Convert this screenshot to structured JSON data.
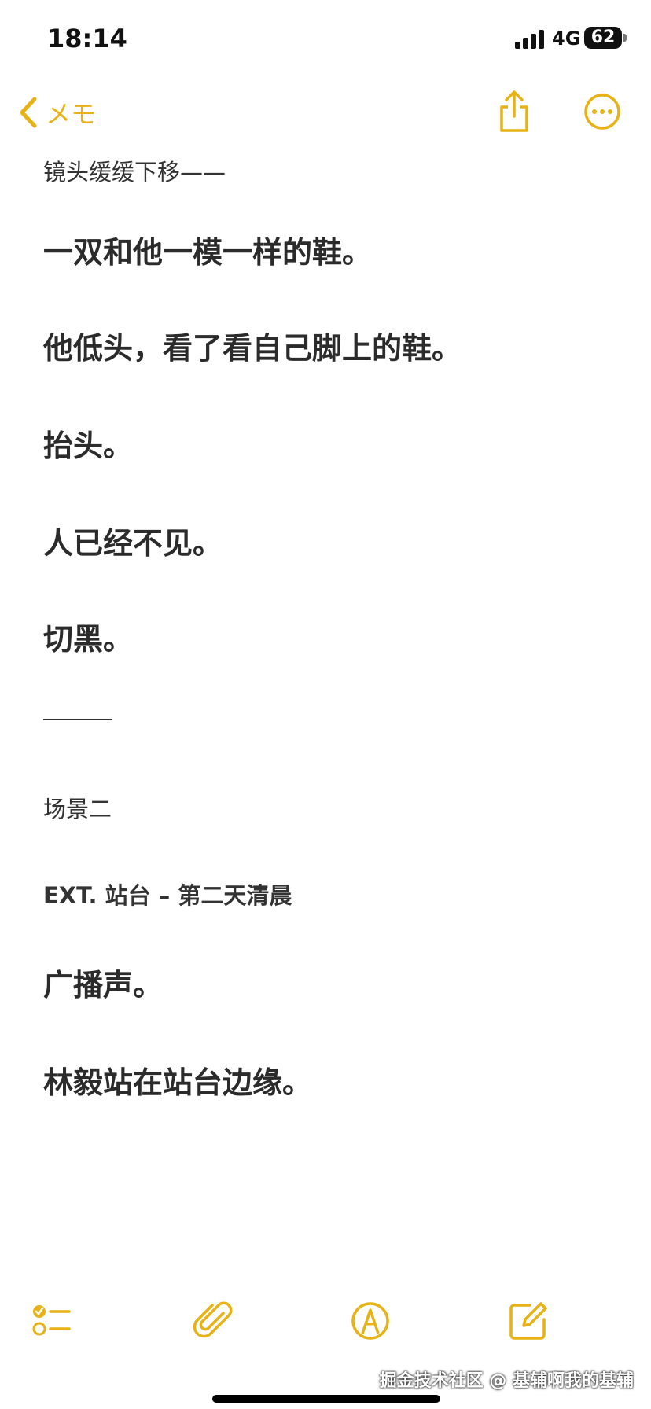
{
  "status_bar": {
    "time": "18:14",
    "network": "4G",
    "battery": "62"
  },
  "nav": {
    "back_label": "メモ",
    "back_icon": "chevron-left-icon",
    "share_icon": "share-icon",
    "more_icon": "ellipsis-circle-icon"
  },
  "note": {
    "lines": [
      "镜头缓缓下移——",
      "一双和他一模一样的鞋。",
      "他低头，看了看自己脚上的鞋。",
      "抬头。",
      "人已经不见。",
      "切黑。",
      "场景二",
      "EXT. 站台 – 第二天清晨",
      "广播声。",
      "林毅站在站台边缘。"
    ]
  },
  "toolbar": {
    "checklist_icon": "checklist-icon",
    "attachment_icon": "paperclip-icon",
    "markup_icon": "markup-pen-icon",
    "compose_icon": "compose-icon"
  },
  "watermark": "掘金技术社区 @ 基辅啊我的基辅",
  "colors": {
    "accent": "#e6b215",
    "text": "#2f2f2f",
    "background": "#ffffff"
  }
}
